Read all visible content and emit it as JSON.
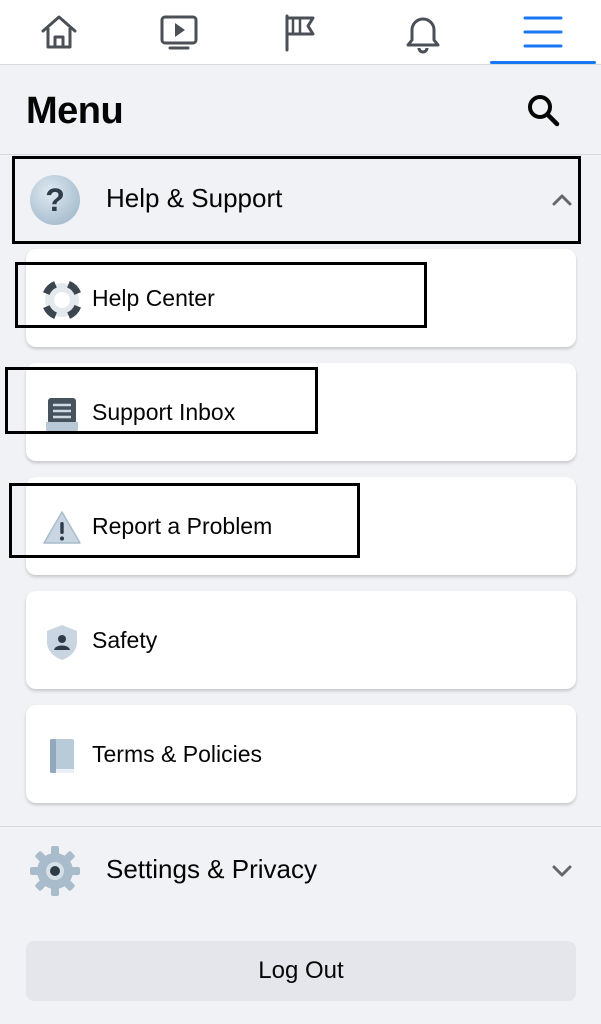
{
  "nav": {
    "items": [
      {
        "name": "home"
      },
      {
        "name": "watch"
      },
      {
        "name": "pages"
      },
      {
        "name": "notifications"
      },
      {
        "name": "menu",
        "active": true
      }
    ],
    "accent": "#1877f2"
  },
  "header": {
    "title": "Menu"
  },
  "help_support": {
    "label": "Help & Support",
    "expanded": true,
    "items": [
      {
        "label": "Help Center"
      },
      {
        "label": "Support Inbox"
      },
      {
        "label": "Report a Problem"
      },
      {
        "label": "Safety"
      },
      {
        "label": "Terms & Policies"
      }
    ]
  },
  "settings_privacy": {
    "label": "Settings & Privacy",
    "expanded": false
  },
  "logout": {
    "label": "Log Out"
  },
  "colors": {
    "background": "#f0f2f5",
    "card": "#ffffff",
    "button": "#e4e6eb",
    "annotation": "#000000"
  }
}
